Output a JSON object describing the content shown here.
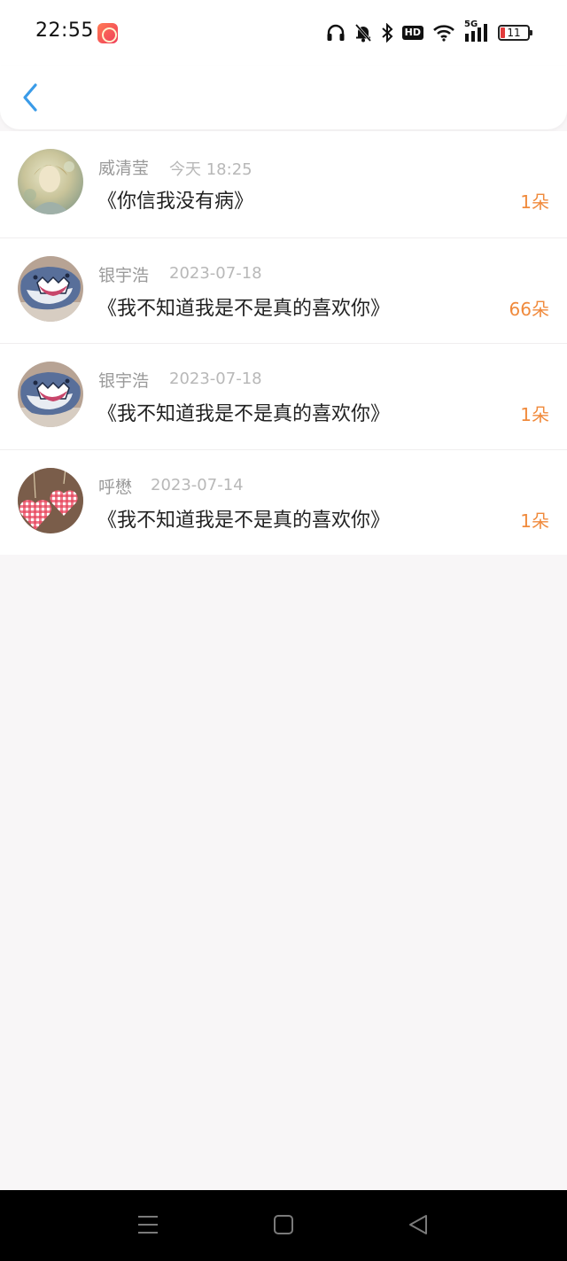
{
  "status": {
    "time": "22:55",
    "battery": "11",
    "network": "5G",
    "hd": "HD",
    "icons": [
      "app-badge-icon",
      "headphones-icon",
      "bell-off-icon",
      "bluetooth-icon",
      "hd-icon",
      "wifi-icon",
      "signal-5g-icon",
      "battery-icon"
    ]
  },
  "header": {
    "back_icon": "chevron-left-icon"
  },
  "list": [
    {
      "name": "威清莹",
      "date": "今天 18:25",
      "title": "《你信我没有病》",
      "count": "1朵",
      "avatar": "vintage-portrait"
    },
    {
      "name": "银宇浩",
      "date": "2023-07-18",
      "title": "《我不知道我是不是真的喜欢你》",
      "count": "66朵",
      "avatar": "cartoon-shark"
    },
    {
      "name": "银宇浩",
      "date": "2023-07-18",
      "title": "《我不知道我是不是真的喜欢你》",
      "count": "1朵",
      "avatar": "cartoon-shark"
    },
    {
      "name": "呼懋",
      "date": "2023-07-14",
      "title": "《我不知道我是不是真的喜欢你》",
      "count": "1朵",
      "avatar": "gingham-hearts"
    }
  ],
  "nav": {
    "icons": [
      "menu-icon",
      "home-icon",
      "back-triangle-icon"
    ]
  },
  "colors": {
    "accent": "#3a9be8",
    "count": "#f08a3c",
    "background": "#f8f6f7"
  }
}
